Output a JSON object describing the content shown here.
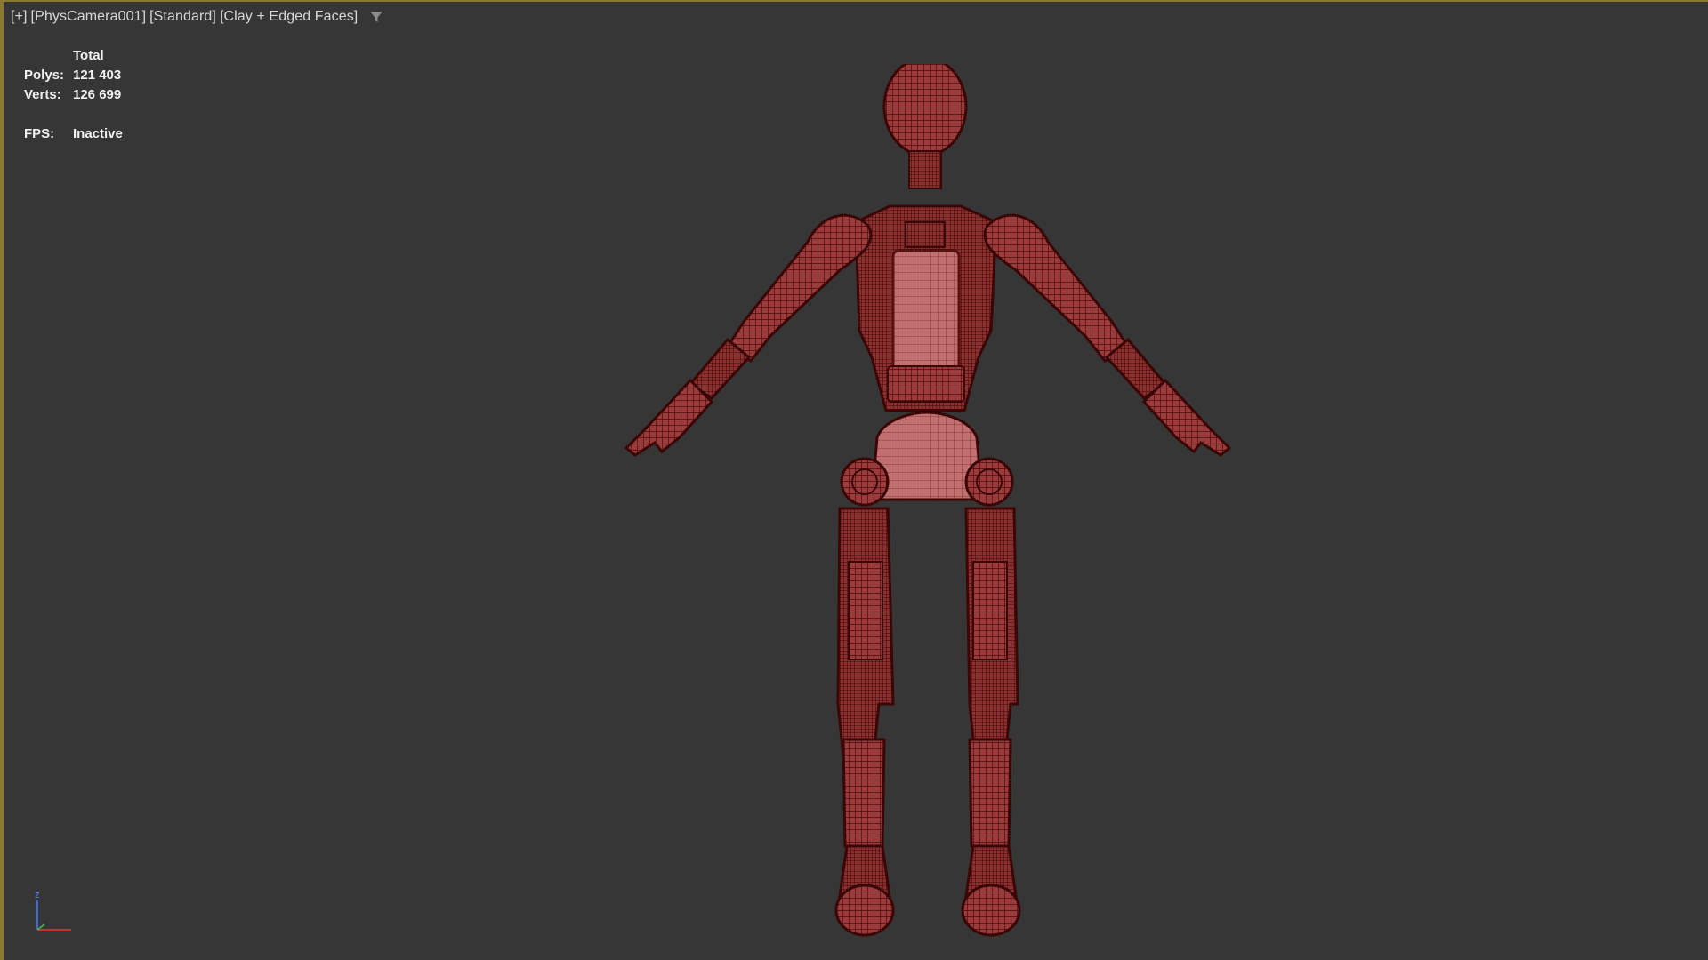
{
  "viewport": {
    "label_parts": [
      "[+]",
      "[PhysCamera001]",
      "[Standard]",
      "[Clay + Edged Faces]"
    ],
    "filter_icon": "filter-icon"
  },
  "stats": {
    "header": "Total",
    "polys_label": "Polys:",
    "polys_value": "121 403",
    "verts_label": "Verts:",
    "verts_value": "126 699",
    "fps_label": "FPS:",
    "fps_value": "Inactive"
  },
  "gizmo": {
    "z_label": "z"
  },
  "colors": {
    "viewport_bg": "#363636",
    "active_border": "#8a7a30",
    "mesh_fill": "#9a3a3a",
    "mesh_wire": "#4a0c0c"
  }
}
